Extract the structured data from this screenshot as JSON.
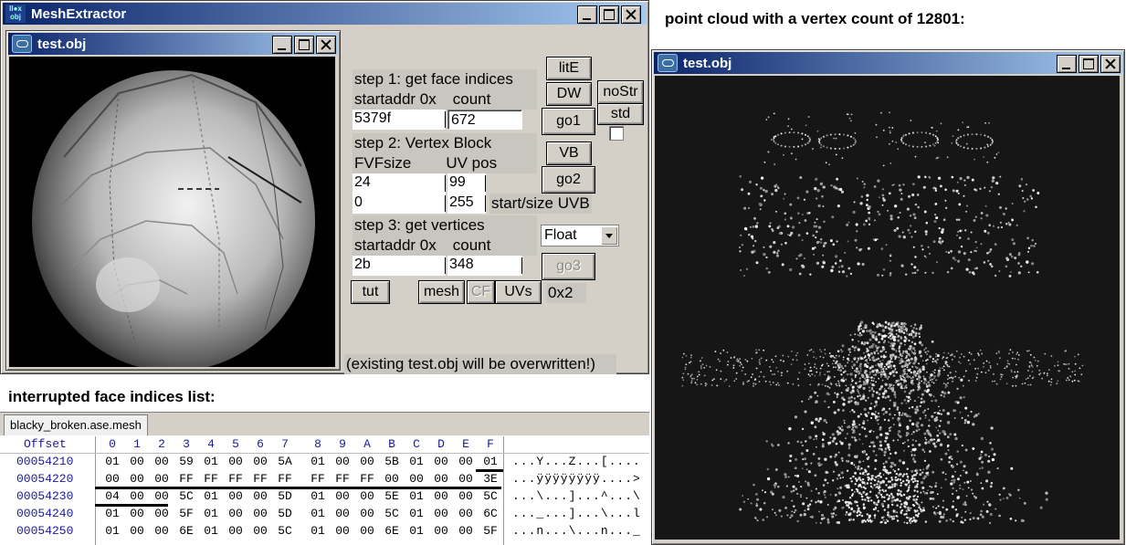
{
  "main_window": {
    "title": "MeshExtractor",
    "app_icon": "obj-icon"
  },
  "child_window": {
    "title": "test.obj"
  },
  "panel": {
    "step1_title": "step 1: get face indices",
    "step1_startaddr": "startaddr 0x",
    "step1_count": "count",
    "step1_addr_value": "5379f",
    "step1_count_value": "672",
    "step2_title": "step 2: Vertex Block",
    "step2_fvf": "FVFsize",
    "step2_uvpos": "UV pos",
    "fvf_value": "24",
    "uvpos_value": "99",
    "uvb_start_value": "0",
    "uvb_size_value": "255",
    "uvb_label": "start/size UVB",
    "step3_title": "step 3: get vertices",
    "step3_startaddr": "startaddr 0x",
    "step3_count": "count",
    "step3_addr_value": "2b",
    "step3_count_value": "348",
    "format_select": "Float",
    "offset_value": "0x2",
    "overwrite_note": "(existing test.obj will be overwritten!)"
  },
  "buttons": {
    "lite": "litE",
    "dw": "DW",
    "nostr": "noStr",
    "std": "std",
    "go1": "go1",
    "vb": "VB",
    "go2": "go2",
    "go3": "go3",
    "tut": "tut",
    "mesh": "mesh",
    "cf": "CF",
    "uvs": "UVs"
  },
  "right_caption": "point cloud with a vertex count of 12801:",
  "right_window": {
    "title": "test.obj"
  },
  "bottom_caption": "interrupted face indices list:",
  "hex_tab": "blacky_broken.ase.mesh",
  "hex_view": {
    "offset_header": "Offset",
    "columns": [
      "0",
      "1",
      "2",
      "3",
      "4",
      "5",
      "6",
      "7",
      "8",
      "9",
      "A",
      "B",
      "C",
      "D",
      "E",
      "F"
    ],
    "rows": [
      {
        "offset": "00054210",
        "bytes": [
          "01",
          "00",
          "00",
          "59",
          "01",
          "00",
          "00",
          "5A",
          "01",
          "00",
          "00",
          "5B",
          "01",
          "00",
          "00",
          "01"
        ],
        "ascii": "...Y...Z...[...."
      },
      {
        "offset": "00054220",
        "bytes": [
          "00",
          "00",
          "00",
          "FF",
          "FF",
          "FF",
          "FF",
          "FF",
          "FF",
          "FF",
          "FF",
          "00",
          "00",
          "00",
          "00",
          "3E"
        ],
        "ascii": "...ÿÿÿÿÿÿÿÿ....>"
      },
      {
        "offset": "00054230",
        "bytes": [
          "04",
          "00",
          "00",
          "5C",
          "01",
          "00",
          "00",
          "5D",
          "01",
          "00",
          "00",
          "5E",
          "01",
          "00",
          "00",
          "5C"
        ],
        "ascii": "...\\...]...^...\\"
      },
      {
        "offset": "00054240",
        "bytes": [
          "01",
          "00",
          "00",
          "5F",
          "01",
          "00",
          "00",
          "5D",
          "01",
          "00",
          "00",
          "5C",
          "01",
          "00",
          "00",
          "6C"
        ],
        "ascii": "..._...]...\\...l"
      },
      {
        "offset": "00054250",
        "bytes": [
          "01",
          "00",
          "00",
          "6E",
          "01",
          "00",
          "00",
          "5C",
          "01",
          "00",
          "00",
          "6E",
          "01",
          "00",
          "00",
          "5F"
        ],
        "ascii": "...n...\\...n..._"
      }
    ]
  }
}
